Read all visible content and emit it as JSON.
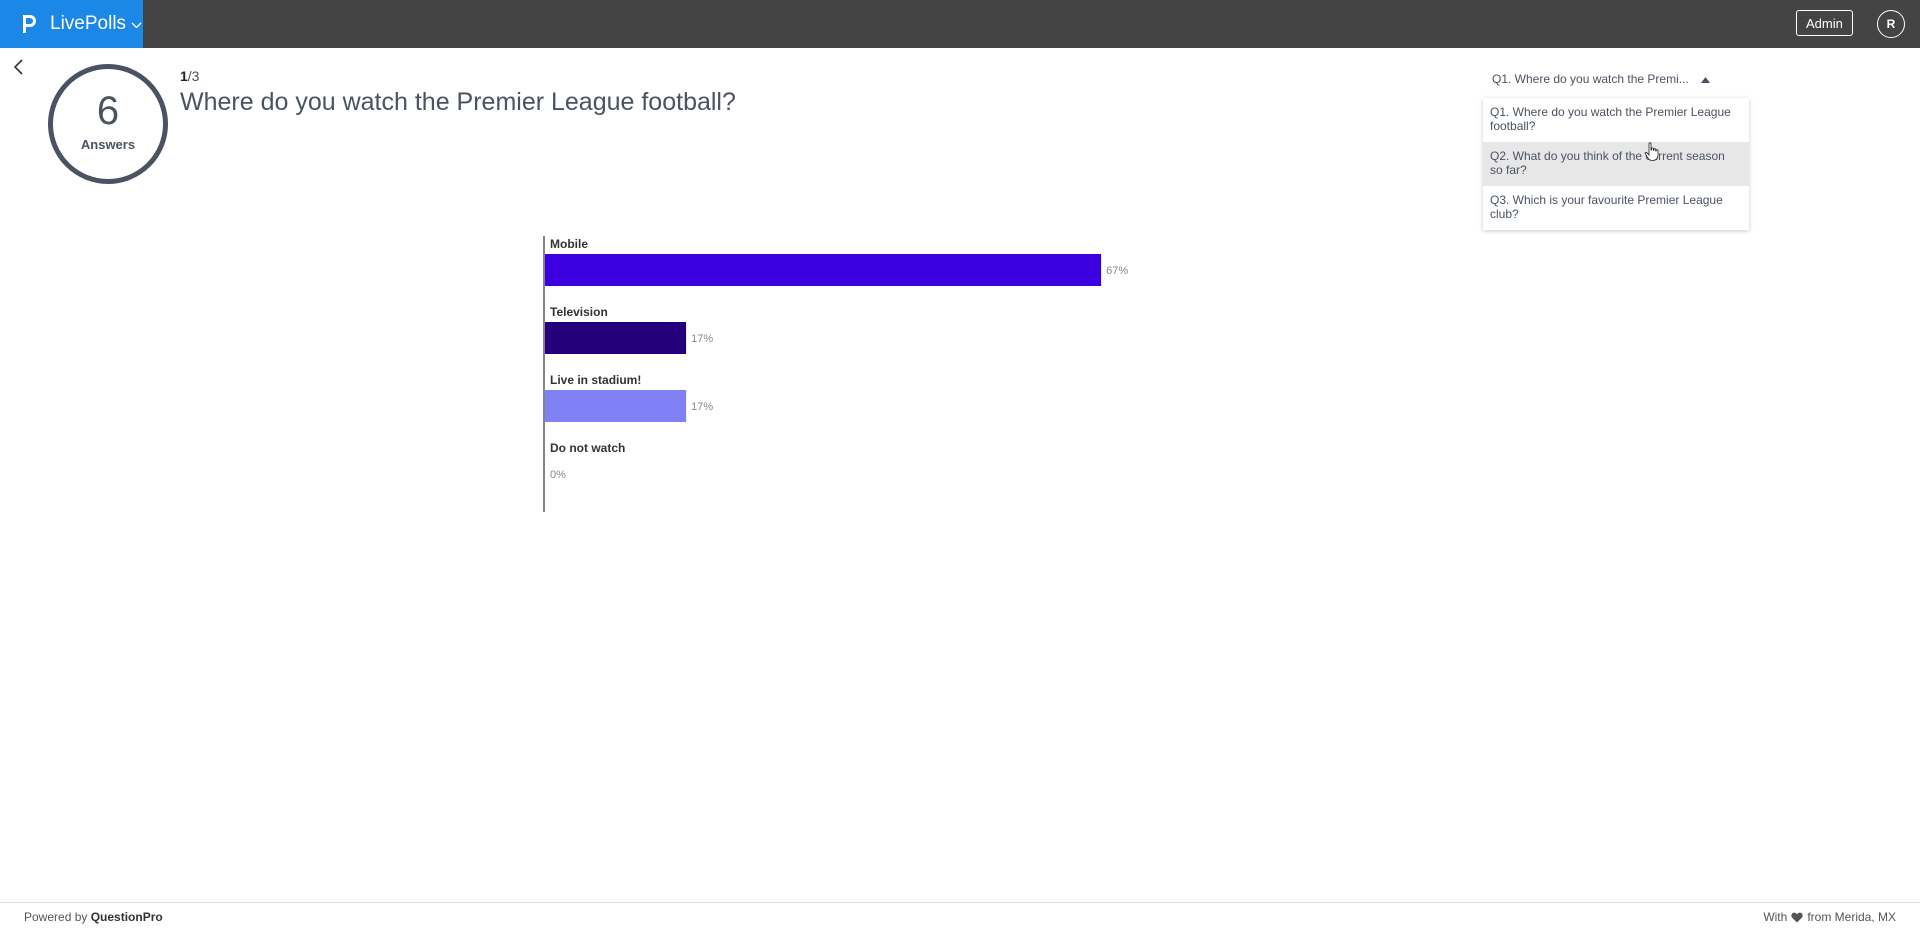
{
  "header": {
    "app_name": "LivePolls",
    "admin_label": "Admin",
    "user_initial": "R",
    "colors": {
      "bar": "#444444",
      "brand": "#1b87e6"
    }
  },
  "summary": {
    "answers_count": "6",
    "answers_label": "Answers",
    "current": "1",
    "total": "/3"
  },
  "question": {
    "title": "Where do you watch the Premier League football?"
  },
  "question_select": {
    "selected": "Q1. Where do you watch the Premi...",
    "options": [
      {
        "line1": "Q1. Where do you watch the Premier League",
        "line2": "football?"
      },
      {
        "line1": "Q2. What do you think of the current season",
        "line2": "so far?"
      },
      {
        "line1": "Q3. Which is your favourite Premier League",
        "line2": "club?"
      }
    ]
  },
  "chart_data": {
    "type": "bar",
    "orientation": "horizontal",
    "categories": [
      "Mobile",
      "Television",
      "Live in stadium!",
      "Do not watch"
    ],
    "values": [
      67,
      17,
      17,
      0
    ],
    "value_labels": [
      "67%",
      "17%",
      "17%",
      "0%"
    ],
    "colors": [
      "#3d00e0",
      "#24007a",
      "#8080f5",
      "#cccccc"
    ],
    "xlim": [
      0,
      100
    ],
    "grid": false,
    "legend": "none"
  },
  "footer": {
    "powered_prefix": "Powered by ",
    "powered_brand": "QuestionPro",
    "with_prefix": "With",
    "with_suffix": "from Merida, MX"
  },
  "icons": [
    "logo-icon",
    "chevron-down-icon",
    "back-arrow-icon",
    "caret-up-icon",
    "hand-cursor-icon",
    "heart-icon"
  ]
}
